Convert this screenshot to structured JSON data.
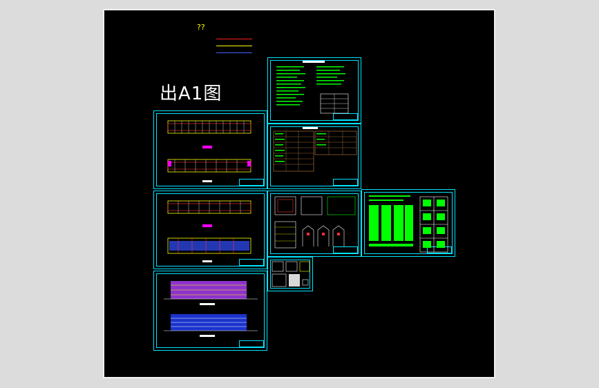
{
  "drawing": {
    "title": "出A1图",
    "legend": {
      "heading": "??",
      "rows": [
        {
          "color": "#ff2020",
          "label_a": "",
          "label_b": ""
        },
        {
          "color": "#ffff00",
          "label_a": "",
          "label_b": ""
        },
        {
          "color": "#4060ff",
          "label_a": "",
          "label_b": ""
        }
      ]
    }
  },
  "colors": {
    "frame": "#00e5ff",
    "text_green": "#00ff00",
    "accent_yellow": "#ffff00",
    "accent_magenta": "#ff00ff",
    "accent_red": "#ff3030",
    "accent_blue": "#3050ff"
  }
}
